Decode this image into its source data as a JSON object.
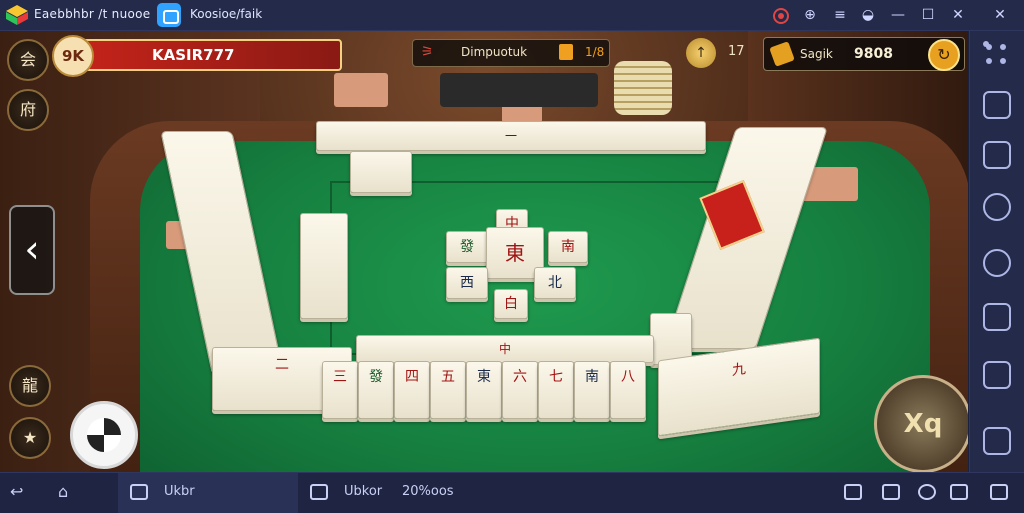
{
  "window": {
    "app_title": "Eaebbhbr /t nuooe",
    "tab_title": "Koosioe/faik",
    "controls": [
      "record",
      "help",
      "menu",
      "location",
      "minimize",
      "maximize",
      "close"
    ],
    "close_glyph": "✕",
    "maximize_glyph": "☐",
    "minimize_glyph": "—",
    "menu_glyph": "≡"
  },
  "game": {
    "top_left_button": "会",
    "side_button": "府",
    "player": {
      "badge": "9K",
      "name": "KASIR777"
    },
    "mode": {
      "label": "Dimpuotuk",
      "value": "1/8"
    },
    "timer_icon": "↑",
    "timer_value": "17",
    "coins": {
      "label": "Sagik",
      "value": "9808",
      "add_icon": "↻"
    },
    "back_arrow": "‹",
    "bottom_left_buttons": [
      "龍",
      "★"
    ],
    "corner_button": "Xq",
    "center_tiles": [
      "中",
      "發",
      "東",
      "南",
      "西",
      "北",
      "白"
    ],
    "tile_glyphs": [
      "一",
      "二",
      "三",
      "四",
      "五",
      "六",
      "七",
      "八",
      "九",
      "中",
      "發",
      "東",
      "南",
      "西",
      "北"
    ],
    "colors": {
      "felt": "#168040",
      "name_bar": "#c8241a",
      "accent_gold": "#f0a020"
    }
  },
  "sidebar": {
    "buttons": [
      "keymap-icon",
      "screen-icon",
      "rotate-icon",
      "sync-icon",
      "settings-icon",
      "screenshot-icon",
      "media-icon",
      "expand-icon"
    ]
  },
  "taskbar": {
    "back_glyph": "↩",
    "home_glyph": "⌂",
    "item1": "Ukbr",
    "item2": "Ubkor",
    "item2_value": "20%oos"
  }
}
